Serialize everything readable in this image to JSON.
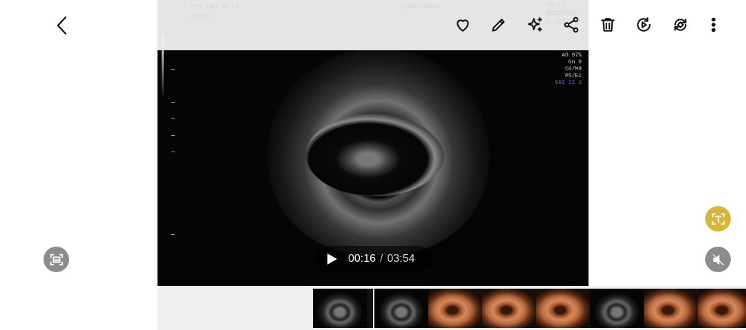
{
  "navigation": {
    "back_icon": "chevron-left-icon"
  },
  "toolbar": {
    "icons": [
      "heart-icon",
      "pencil-icon",
      "sparkles-icon",
      "share-icon",
      "trash-icon",
      "play-circle-icon",
      "rotate-icon",
      "more-vert-icon"
    ]
  },
  "video": {
    "overlay_header": {
      "left_line1": "HYX KAH, JO  13",
      "left_line2": "6TTSS",
      "center": "Hybrid CB6Hz"
    },
    "scanner_info": [
      "TIb 0.1",
      "2022/05/13",
      "11:24:57",
      "AO 97%",
      "Gn  0",
      "C6/M8",
      "P5/E1",
      "SRI II 3"
    ],
    "current_time": "00:16",
    "separator": "/",
    "duration": "03:54",
    "playing": false
  },
  "side_controls": {
    "capture_icon": "screen-capture-icon",
    "text_recognition_icon": "text-extract-icon",
    "mute_icon": "speaker-muted-icon"
  },
  "filmstrip": {
    "frames": [
      "ultrasound",
      "ultrasound",
      "3d",
      "3d",
      "3d",
      "ultrasound",
      "3d",
      "3d",
      "3d"
    ],
    "current_frame": 1
  },
  "colors": {
    "text_button": "#d9b53b",
    "side_button": "#8c8c8c",
    "toolbar_icon": "#111111"
  }
}
